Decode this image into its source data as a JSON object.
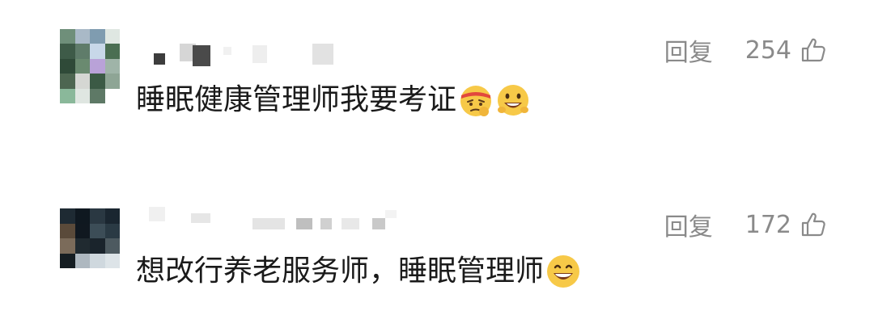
{
  "comments": [
    {
      "avatar": "blurred-avatar",
      "username": "",
      "reply_label": "回复",
      "likes": "254",
      "text": "睡眠健康管理师我要考证",
      "emojis": [
        "determined-headband-emoji",
        "grinning-peace-emoji"
      ]
    },
    {
      "avatar": "blurred-avatar",
      "username": "",
      "reply_label": "回复",
      "likes": "172",
      "text": "想改行养老服务师，睡眠管理师",
      "emojis": [
        "big-smile-emoji"
      ]
    }
  ],
  "icons": {
    "like": "thumbs-up-icon"
  },
  "colors": {
    "text": "#1a1a1a",
    "meta": "#8a8a8a",
    "emoji_yellow": "#f7c948"
  }
}
